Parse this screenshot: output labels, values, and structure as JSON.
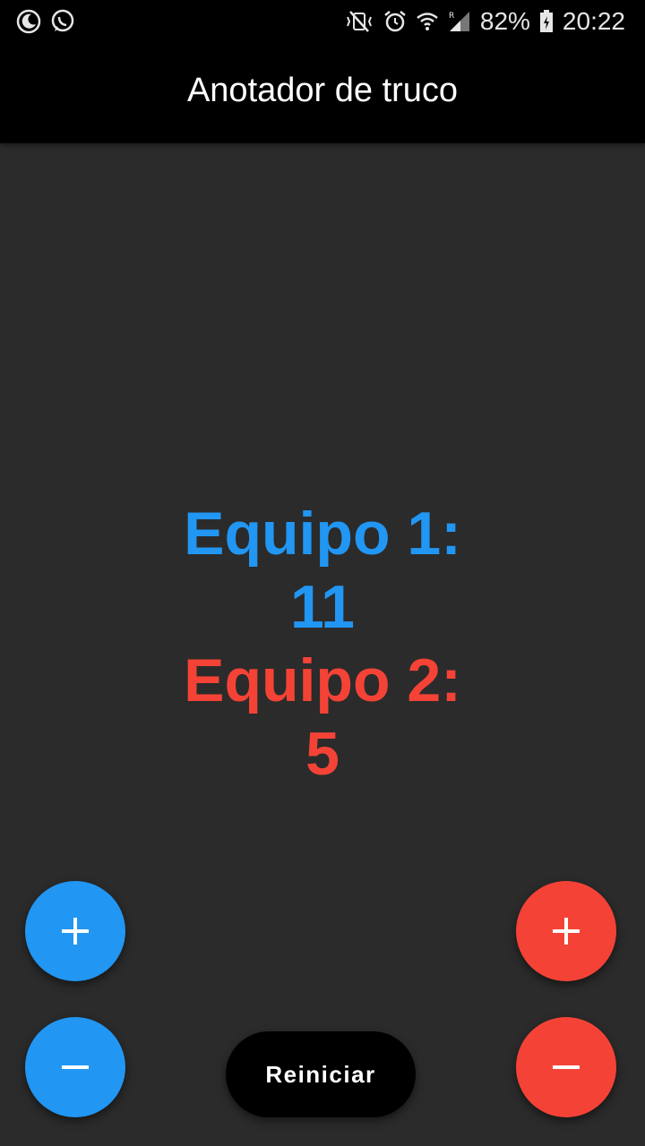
{
  "status_bar": {
    "battery": "82%",
    "time": "20:22",
    "left_icons": [
      "moon-icon",
      "whatsapp-icon"
    ],
    "right_icons": [
      "mute-vibrate-icon",
      "alarm-icon",
      "wifi-icon",
      "signal-icon",
      "battery-icon"
    ]
  },
  "app_bar": {
    "title": "Anotador de truco"
  },
  "scores": {
    "team1": {
      "label": "Equipo 1:",
      "value": "11",
      "color": "#2196f3"
    },
    "team2": {
      "label": "Equipo 2:",
      "value": "5",
      "color": "#f44336"
    }
  },
  "buttons": {
    "team1_plus_icon": "plus-icon",
    "team1_minus_icon": "minus-icon",
    "team2_plus_icon": "plus-icon",
    "team2_minus_icon": "minus-icon",
    "reset_label": "Reiniciar"
  }
}
